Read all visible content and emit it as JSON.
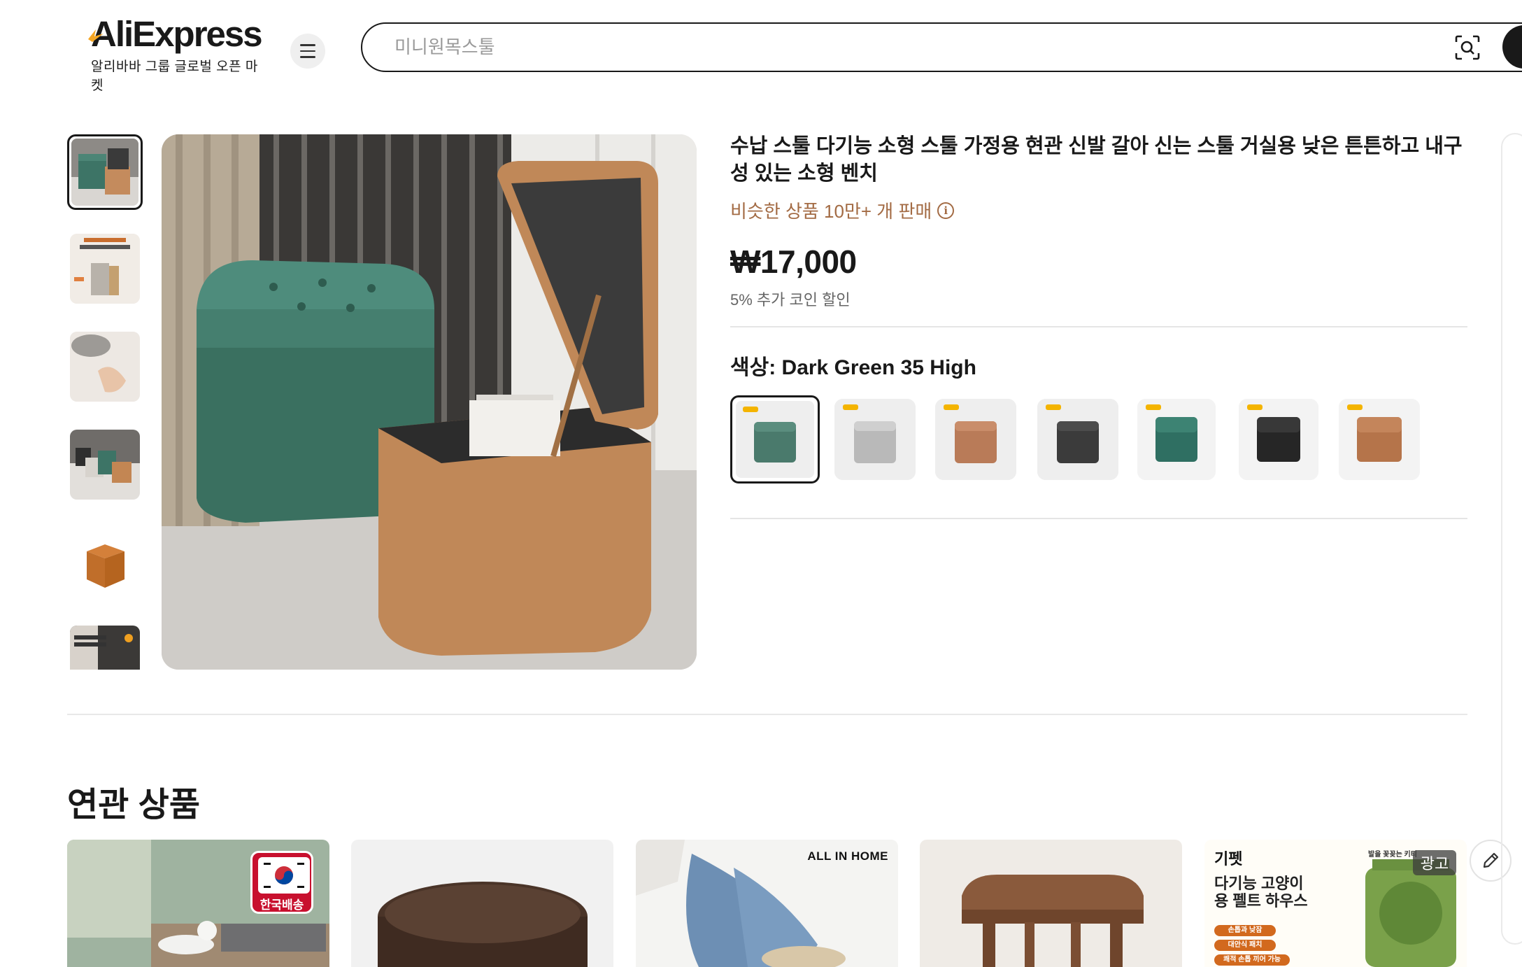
{
  "header": {
    "logo_text": "AliExpress",
    "logo_subtitle": "알리바바 그룹 글로벌 오픈 마켓",
    "menu_icon": "hamburger-menu-icon",
    "search_placeholder": "미니원목스툴",
    "camera_icon": "camera-search-icon"
  },
  "product": {
    "title": "수납 스툴 다기능 소형 스툴 가정용 현관 신발 갈아 신는 스툴 거실용 낮은 튼튼하고 내구성 있는 소형 벤치",
    "sold_text": "비슷한 상품 10만+ 개 판매",
    "info_icon": "info-circle-icon",
    "price": "₩17,000",
    "coin_discount": "5% 추가 코인 할인",
    "color_label": "색상: Dark Green 35 High",
    "selected_color_index": 0,
    "swatch_colors": [
      "#4a7a6c",
      "#b9b9b9",
      "#b97b58",
      "#3b3b3b",
      "#2f6f62",
      "#262626",
      "#b5744a"
    ],
    "swatch_badges": [
      "",
      "",
      "",
      "",
      "",
      "",
      ""
    ]
  },
  "gallery": {
    "active_index": 0,
    "thumb_count_visible": 6
  },
  "related": {
    "title": "연관 상품",
    "ad_label": "광고",
    "edit_icon": "pencil-edit-icon",
    "cards": [
      {
        "badge": "한국배송"
      },
      {
        "badge": ""
      },
      {
        "badge": "ALL IN HOME"
      },
      {
        "badge": ""
      },
      {
        "brand": "기펫",
        "headline_line1": "다기능 고양이",
        "headline_line2": "용 펠트 하우스",
        "chip1": "손톱과 낮잠",
        "chip2": "대안식 패치",
        "chip3": "쾌적 손톱 끼어 가능",
        "corner": "발을 꽃꽂는 키티"
      }
    ]
  },
  "colors": {
    "text": "#191919",
    "sold": "#a36b44",
    "muted": "#666666"
  }
}
